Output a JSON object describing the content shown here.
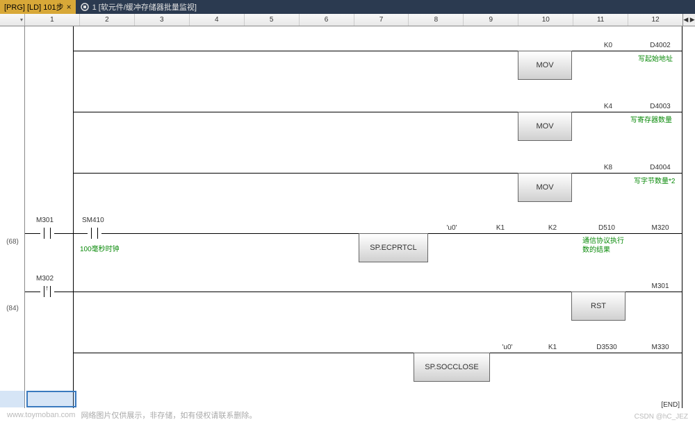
{
  "tabs": {
    "active": {
      "label": "[PRG] [LD] 101步",
      "close": "×"
    },
    "inactive": {
      "label": "1 [软元件/缓冲存储器批量监视]"
    }
  },
  "ruler": {
    "columns": [
      "1",
      "2",
      "3",
      "4",
      "5",
      "6",
      "7",
      "8",
      "9",
      "10",
      "11",
      "12"
    ],
    "end": "◀ ▶"
  },
  "steps": {
    "s68": "(68)",
    "s84": "(84)"
  },
  "rung_mov": [
    {
      "instr": "MOV",
      "p1": "K0",
      "p2": "D4002",
      "comment": "写起始地址"
    },
    {
      "instr": "MOV",
      "p1": "K4",
      "p2": "D4003",
      "comment": "写寄存器数量"
    },
    {
      "instr": "MOV",
      "p1": "K8",
      "p2": "D4004",
      "comment": "写字节数量*2"
    }
  ],
  "rung68": {
    "contacts": [
      {
        "label": "M301"
      },
      {
        "label": "SM410",
        "comment": "100毫秒时钟"
      }
    ],
    "instr": "SP.ECPRTCL",
    "ops": [
      "'u0'",
      "K1",
      "K2",
      "D510",
      "M320"
    ],
    "comment": "通信协议执行数的结果"
  },
  "rung84": {
    "contact": {
      "label": "M302"
    },
    "rst": {
      "instr": "RST",
      "op": "M301"
    },
    "socclose": {
      "instr": "SP.SOCCLOSE",
      "ops": [
        "'u0'",
        "K1",
        "D3530",
        "M330"
      ]
    }
  },
  "end_marker": "[END]",
  "footer": {
    "watermark": "www.toymoban.com",
    "disclaimer": "网络图片仅供展示，非存储，如有侵权请联系删除。",
    "right": "CSDN @hC_JEZ"
  }
}
